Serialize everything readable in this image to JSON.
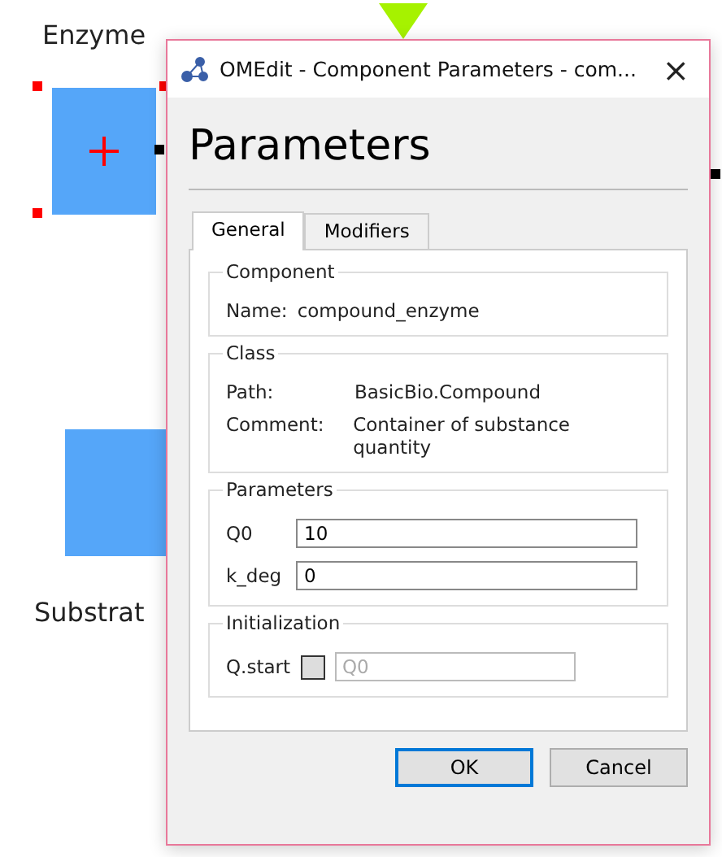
{
  "canvas": {
    "labels": [
      {
        "kind": "enzyme",
        "text": "Enzyme"
      },
      {
        "kind": "substrate",
        "text": "Substrat"
      }
    ]
  },
  "dialog": {
    "title": "OMEdit - Component Parameters - com...",
    "close": "×",
    "heading": "Parameters",
    "tabs": [
      {
        "label": "General",
        "selected": true
      },
      {
        "label": "Modifiers",
        "selected": false
      }
    ],
    "component": {
      "title": "Component",
      "rows": [
        {
          "label": "Name:",
          "value": "compound_enzyme"
        }
      ]
    },
    "class": {
      "title": "Class",
      "rows": [
        {
          "label": "Path:",
          "value": "BasicBio.Compound"
        },
        {
          "label": "Comment:",
          "value": "Container of substance quantity"
        }
      ]
    },
    "parameters": {
      "title": "Parameters",
      "fields": [
        {
          "label": "Q0",
          "value": "10"
        },
        {
          "label": "k_deg",
          "value": "0"
        }
      ]
    },
    "initialization": {
      "title": "Initialization",
      "fields": [
        {
          "label": "Q.start",
          "checked": false,
          "placeholder": "Q0",
          "disabled": true
        }
      ]
    },
    "buttons": [
      {
        "label": "OK",
        "default": true
      },
      {
        "label": "Cancel",
        "default": false
      }
    ]
  }
}
